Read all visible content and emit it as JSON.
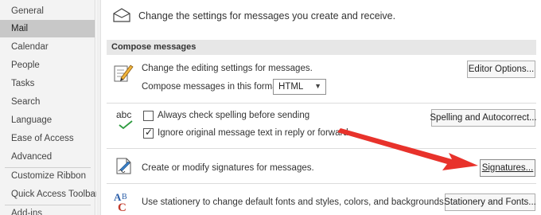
{
  "sidebar": {
    "items": [
      {
        "label": "General"
      },
      {
        "label": "Mail"
      },
      {
        "label": "Calendar"
      },
      {
        "label": "People"
      },
      {
        "label": "Tasks"
      },
      {
        "label": "Search"
      },
      {
        "label": "Language"
      },
      {
        "label": "Ease of Access"
      },
      {
        "label": "Advanced"
      },
      {
        "label": "Customize Ribbon"
      },
      {
        "label": "Quick Access Toolbar"
      },
      {
        "label": "Add-ins"
      }
    ],
    "selected": "Mail"
  },
  "header": {
    "text": "Change the settings for messages you create and receive."
  },
  "compose": {
    "section_title": "Compose messages",
    "editing_text": "Change the editing settings for messages.",
    "editor_options_button": "Editor Options...",
    "format_label": "Compose messages in this format:",
    "format_value": "HTML",
    "spelling_icon_text": "abc",
    "always_check_label": "Always check spelling before sending",
    "always_check_checked": false,
    "ignore_original_label": "Ignore original message text in reply or forward",
    "ignore_original_checked": true,
    "spelling_button": "Spelling and Autocorrect...",
    "signatures_text": "Create or modify signatures for messages.",
    "signatures_button": "Signatures...",
    "stationery_text": "Use stationery to change default fonts and styles, colors, and backgrounds.",
    "stationery_button": "Stationery and Fonts..."
  },
  "colors": {
    "arrow": "#e8322b",
    "selected_nav": "#c8c8c8",
    "section_bar": "#e7e7e7"
  }
}
